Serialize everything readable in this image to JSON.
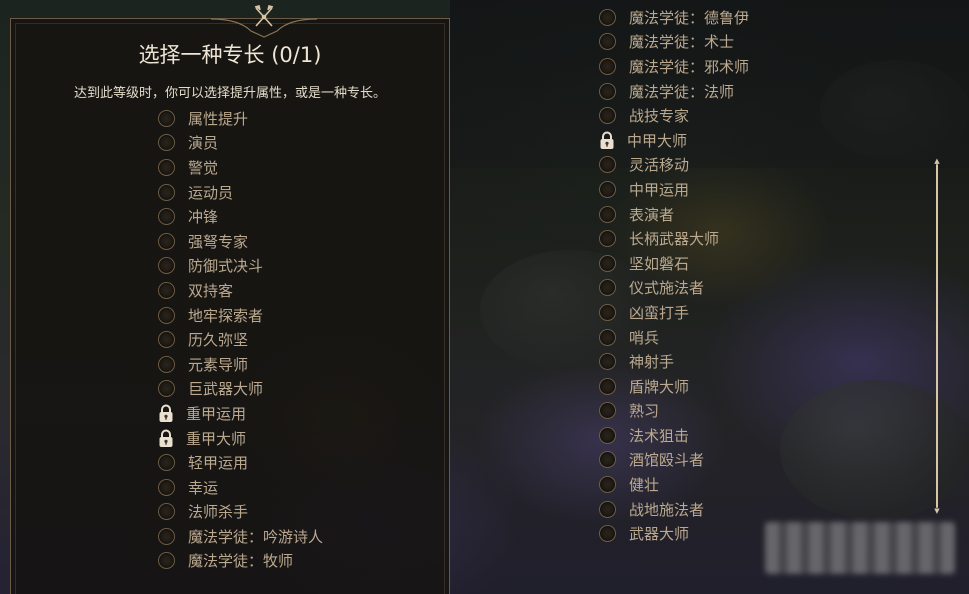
{
  "panel": {
    "title": "选择一种专长 (0/1)",
    "subtitle": "达到此等级时，你可以选择提升属性，或是一种专长。"
  },
  "icons": {
    "ornament": "crossed-axes-icon",
    "radio": "radio-circle-icon",
    "lock": "padlock-icon"
  },
  "colors": {
    "label": "#bba98f",
    "title": "#efe5d4",
    "border": "#6b5a45",
    "scrollbar": "#d8c6a6"
  },
  "left_list": [
    {
      "label": "属性提升",
      "locked": false
    },
    {
      "label": "演员",
      "locked": false
    },
    {
      "label": "警觉",
      "locked": false
    },
    {
      "label": "运动员",
      "locked": false
    },
    {
      "label": "冲锋",
      "locked": false
    },
    {
      "label": "强弩专家",
      "locked": false
    },
    {
      "label": "防御式决斗",
      "locked": false
    },
    {
      "label": "双持客",
      "locked": false
    },
    {
      "label": "地牢探索者",
      "locked": false
    },
    {
      "label": "历久弥坚",
      "locked": false
    },
    {
      "label": "元素导师",
      "locked": false
    },
    {
      "label": "巨武器大师",
      "locked": false
    },
    {
      "label": "重甲运用",
      "locked": true
    },
    {
      "label": "重甲大师",
      "locked": true
    },
    {
      "label": "轻甲运用",
      "locked": false
    },
    {
      "label": "幸运",
      "locked": false
    },
    {
      "label": "法师杀手",
      "locked": false
    },
    {
      "label": "魔法学徒：吟游诗人",
      "locked": false
    },
    {
      "label": "魔法学徒：牧师",
      "locked": false
    }
  ],
  "right_list": [
    {
      "label": "魔法学徒：德鲁伊",
      "locked": false
    },
    {
      "label": "魔法学徒：术士",
      "locked": false
    },
    {
      "label": "魔法学徒：邪术师",
      "locked": false
    },
    {
      "label": "魔法学徒：法师",
      "locked": false
    },
    {
      "label": "战技专家",
      "locked": false
    },
    {
      "label": "中甲大师",
      "locked": true
    },
    {
      "label": "灵活移动",
      "locked": false
    },
    {
      "label": "中甲运用",
      "locked": false
    },
    {
      "label": "表演者",
      "locked": false
    },
    {
      "label": "长柄武器大师",
      "locked": false
    },
    {
      "label": "坚如磐石",
      "locked": false
    },
    {
      "label": "仪式施法者",
      "locked": false
    },
    {
      "label": "凶蛮打手",
      "locked": false
    },
    {
      "label": "哨兵",
      "locked": false
    },
    {
      "label": "神射手",
      "locked": false
    },
    {
      "label": "盾牌大师",
      "locked": false
    },
    {
      "label": "熟习",
      "locked": false
    },
    {
      "label": "法术狙击",
      "locked": false
    },
    {
      "label": "酒馆殴斗者",
      "locked": false
    },
    {
      "label": "健壮",
      "locked": false
    },
    {
      "label": "战地施法者",
      "locked": false
    },
    {
      "label": "武器大师",
      "locked": false
    }
  ]
}
